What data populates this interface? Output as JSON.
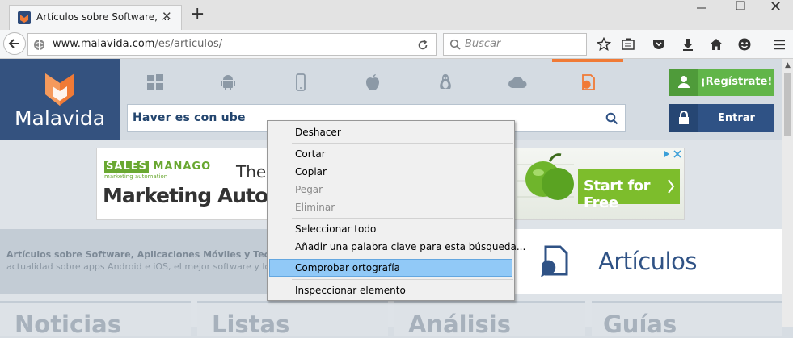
{
  "browser": {
    "tab_title": "Artículos sobre Software, ...",
    "tab_close": "✕",
    "new_tab": "+",
    "url_domain": "www.malavida.com",
    "url_path": "/es/articulos/",
    "search_placeholder": "Buscar"
  },
  "site": {
    "logo_text": "Malavida",
    "platforms": [
      "windows-icon",
      "android-icon",
      "iphone-icon",
      "apple-icon",
      "linux-icon",
      "cloud-icon",
      "articles-icon"
    ],
    "search_value": "Haver es con ube",
    "register_label": "¡Regístrate!",
    "login_label": "Entrar",
    "colors": {
      "brand_blue": "#34527f",
      "accent_orange": "#f07a36",
      "register_green": "#61b549"
    }
  },
  "ad": {
    "brand_box": "SALES",
    "brand_rest": "MANAGO",
    "tagline": "marketing automation",
    "intro": "The e",
    "headline": "Marketing Automat",
    "cta": "Start for Free"
  },
  "section": {
    "desc_title": "Artículos sobre Software, Aplicaciones Móviles y Tec",
    "desc_text": "actualidad sobre apps Android e iOS, el mejor software y lo",
    "articles_title": "Artículos",
    "bottom_tabs": [
      "Noticias",
      "Listas",
      "Análisis",
      "Guías"
    ]
  },
  "context_menu": {
    "items": [
      {
        "label": "Deshacer",
        "disabled": false
      },
      {
        "label": "Cortar",
        "disabled": false
      },
      {
        "label": "Copiar",
        "disabled": false
      },
      {
        "label": "Pegar",
        "disabled": true
      },
      {
        "label": "Eliminar",
        "disabled": true
      },
      {
        "label": "Seleccionar todo",
        "disabled": false
      },
      {
        "label": "Añadir una palabra clave para esta búsqueda...",
        "disabled": false
      },
      {
        "label": "Comprobar ortografía",
        "disabled": false,
        "highlighted": true
      },
      {
        "label": "Inspeccionar elemento",
        "disabled": false
      }
    ]
  }
}
